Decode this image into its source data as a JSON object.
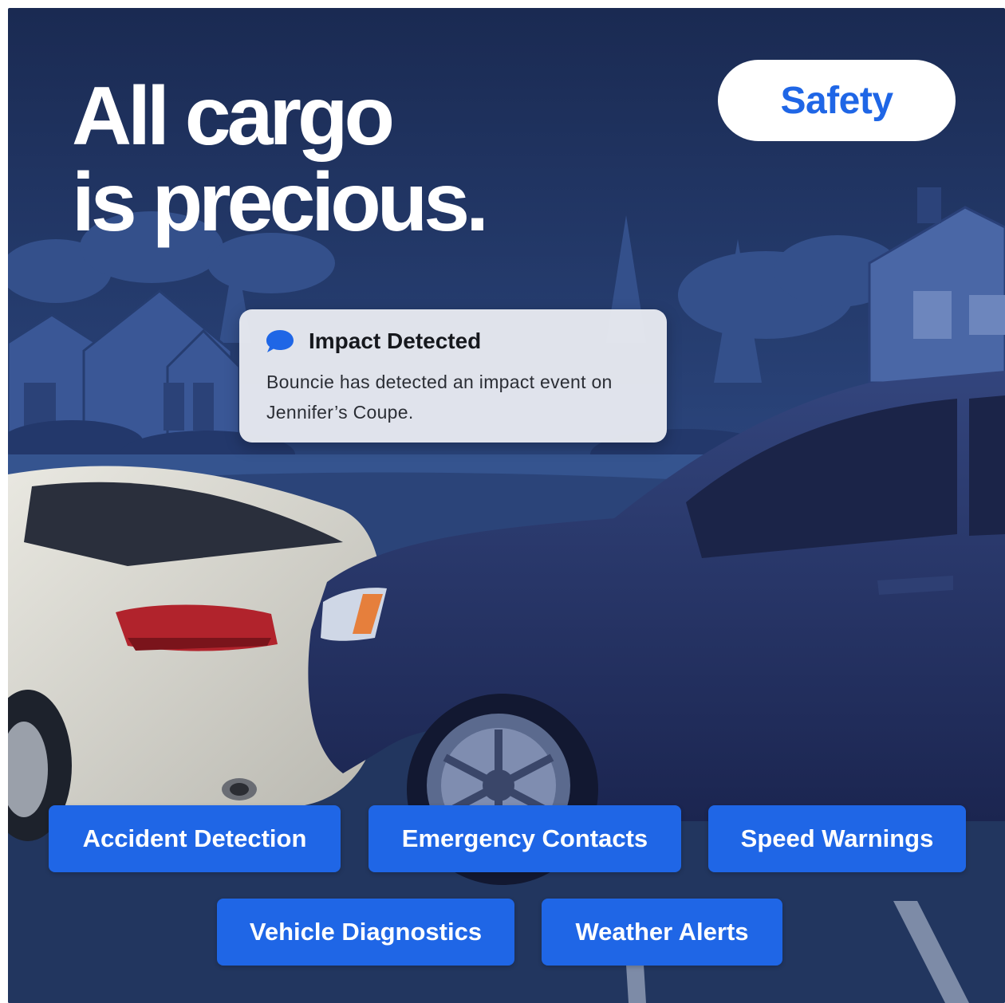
{
  "headline": {
    "line1": "All cargo",
    "line2": "is precious."
  },
  "tag": {
    "label": "Safety"
  },
  "notification": {
    "icon": "chat-bubble-icon",
    "title": "Impact Detected",
    "body": "Bouncie has detected an impact event on Jennifer’s Coupe."
  },
  "features": [
    "Accident Detection",
    "Emergency Contacts",
    "Speed Warnings",
    "Vehicle Diagnostics",
    "Weather Alerts"
  ],
  "colors": {
    "accent": "#1f66e6",
    "scene_background": "#24386a",
    "notification_background": "#e8eaf0",
    "white": "#ffffff"
  }
}
